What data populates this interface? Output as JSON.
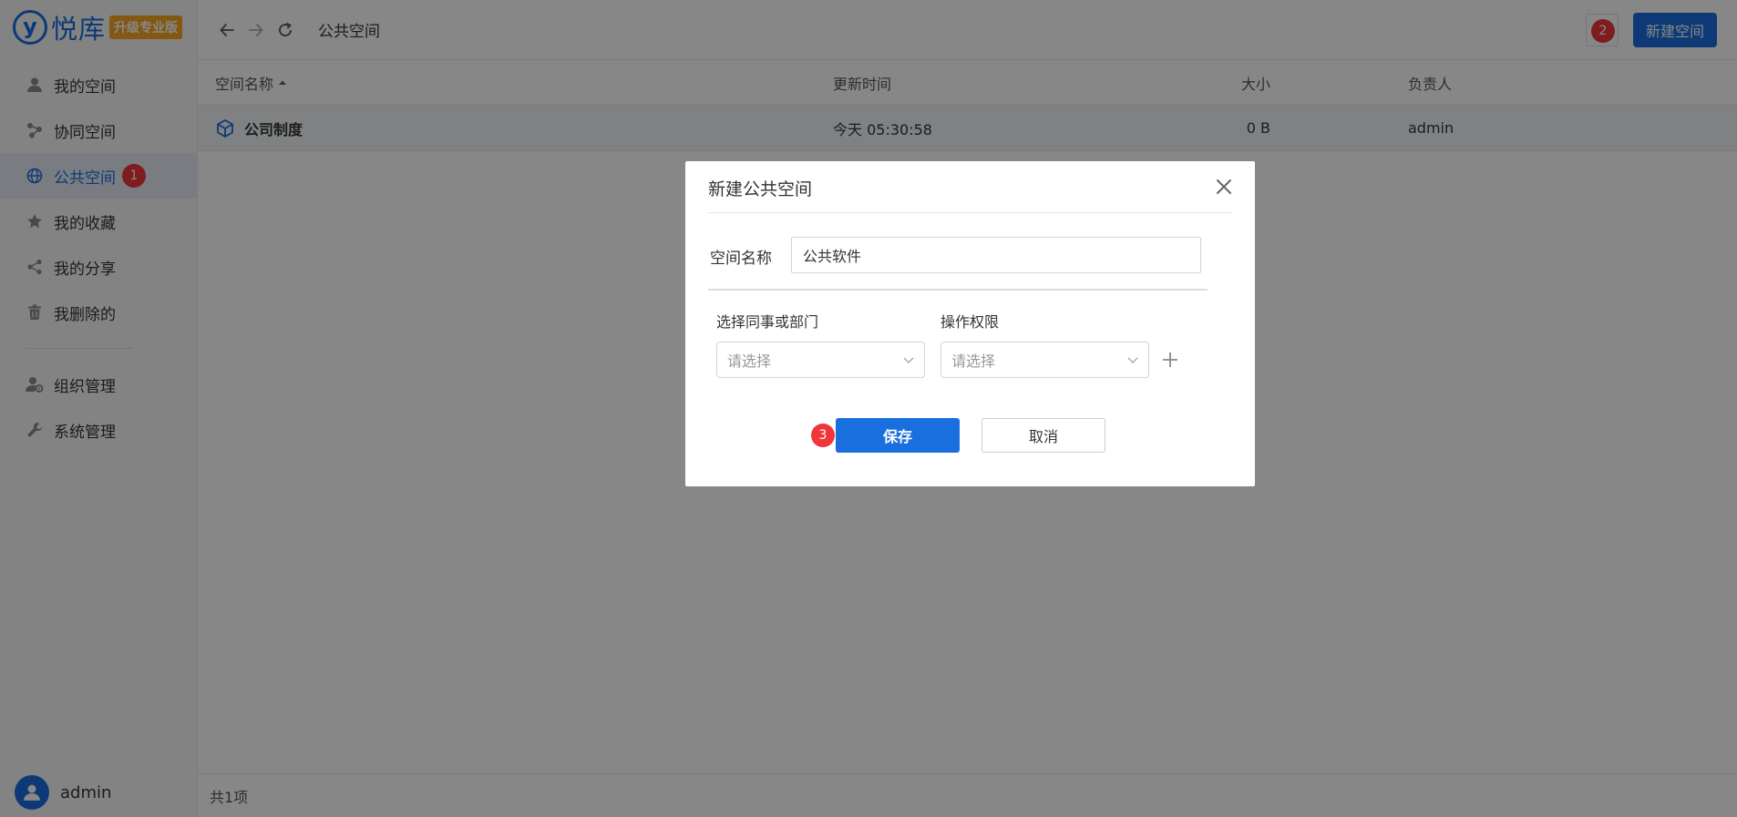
{
  "sidebar": {
    "logo": {
      "mark": "y",
      "name": "悦库",
      "badge": "升级专业版"
    },
    "items": [
      {
        "label": "我的空间",
        "icon": "user-icon"
      },
      {
        "label": "协同空间",
        "icon": "collab-icon"
      },
      {
        "label": "公共空间",
        "icon": "globe-icon",
        "active": true,
        "badge": "1"
      },
      {
        "label": "我的收藏",
        "icon": "star-icon"
      },
      {
        "label": "我的分享",
        "icon": "share-icon"
      },
      {
        "label": "我删除的",
        "icon": "trash-icon"
      }
    ],
    "admin_items": [
      {
        "label": "组织管理",
        "icon": "org-settings-icon"
      },
      {
        "label": "系统管理",
        "icon": "wrench-icon"
      }
    ],
    "user": {
      "name": "admin"
    }
  },
  "topbar": {
    "breadcrumb": "公共空间",
    "square_badge": "2",
    "new_space_button": "新建空间"
  },
  "table": {
    "headers": {
      "name": "空间名称",
      "time": "更新时间",
      "size": "大小",
      "owner": "负责人"
    },
    "rows": [
      {
        "name": "公司制度",
        "time": "今天 05:30:58",
        "size": "0 B",
        "owner": "admin"
      }
    ],
    "footer": "共1项"
  },
  "modal": {
    "title": "新建公共空间",
    "name_label": "空间名称",
    "name_value": "公共软件",
    "member_label": "选择同事或部门",
    "permission_label": "操作权限",
    "member_placeholder": "请选择",
    "permission_placeholder": "请选择",
    "save_label": "保存",
    "cancel_label": "取消",
    "save_badge": "3"
  },
  "colors": {
    "accent": "#1a6fdf",
    "badge": "#f0363a",
    "brand_badge": "#f5a623",
    "overlay": "rgba(0,0,0,0.47)"
  }
}
